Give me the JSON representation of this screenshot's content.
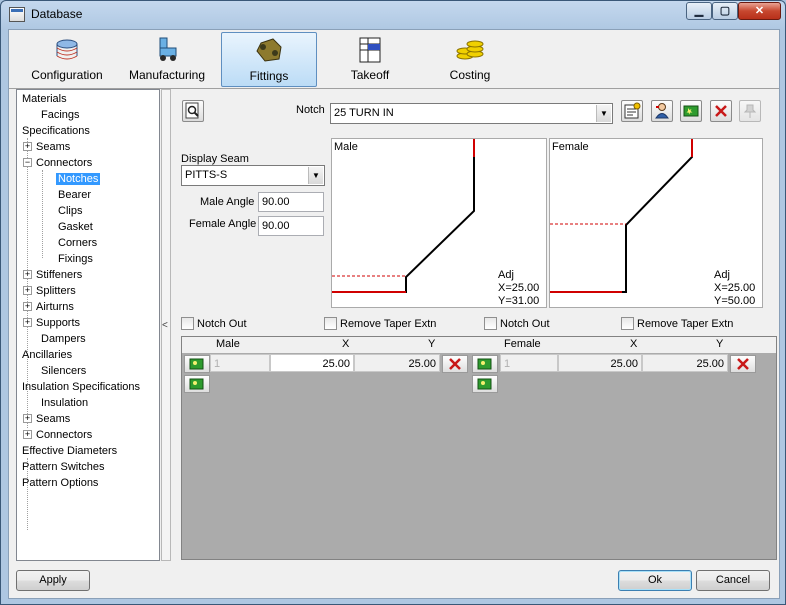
{
  "window": {
    "title": "Database"
  },
  "toolbar": {
    "items": [
      {
        "label": "Configuration",
        "icon": "configuration-icon"
      },
      {
        "label": "Manufacturing",
        "icon": "manufacturing-icon"
      },
      {
        "label": "Fittings",
        "icon": "fittings-icon",
        "active": true
      },
      {
        "label": "Takeoff",
        "icon": "takeoff-icon"
      },
      {
        "label": "Costing",
        "icon": "costing-icon"
      }
    ]
  },
  "tree": {
    "items": [
      {
        "label": "Materials"
      },
      {
        "label": "Facings"
      },
      {
        "label": "Specifications"
      },
      {
        "label": "Seams",
        "expander": "+"
      },
      {
        "label": "Connectors",
        "expander": "−"
      },
      {
        "label": "Notches",
        "selected": true
      },
      {
        "label": "Bearer"
      },
      {
        "label": "Clips"
      },
      {
        "label": "Gasket"
      },
      {
        "label": "Corners"
      },
      {
        "label": "Fixings"
      },
      {
        "label": "Stiffeners",
        "expander": "+"
      },
      {
        "label": "Splitters",
        "expander": "+"
      },
      {
        "label": "Airturns",
        "expander": "+"
      },
      {
        "label": "Supports",
        "expander": "+"
      },
      {
        "label": "Dampers"
      },
      {
        "label": "Ancillaries"
      },
      {
        "label": "Silencers"
      },
      {
        "label": "Insulation Specifications"
      },
      {
        "label": "Insulation"
      },
      {
        "label": "Seams",
        "expander": "+"
      },
      {
        "label": "Connectors",
        "expander": "+"
      },
      {
        "label": "Effective Diameters"
      },
      {
        "label": "Pattern Switches"
      },
      {
        "label": "Pattern Options"
      }
    ],
    "splitter_glyph": "<"
  },
  "notch": {
    "label": "Notch",
    "value": "25 TURN IN"
  },
  "display_seam": {
    "label": "Display Seam",
    "value": "PITTS-S"
  },
  "male_angle": {
    "label": "Male Angle",
    "value": "90.00"
  },
  "female_angle": {
    "label": "Female Angle",
    "value": "90.00"
  },
  "preview_male": {
    "title": "Male",
    "adj": "Adj",
    "x": "X=25.00",
    "y": "Y=31.00"
  },
  "preview_female": {
    "title": "Female",
    "adj": "Adj",
    "x": "X=25.00",
    "y": "Y=50.00"
  },
  "checks": {
    "male_notch_out": "Notch Out",
    "male_remove_taper": "Remove Taper Extn",
    "female_notch_out": "Notch Out",
    "female_remove_taper": "Remove Taper Extn"
  },
  "grid": {
    "male": {
      "headers": [
        "Male",
        "X",
        "Y"
      ],
      "row": {
        "index": "1",
        "x": "25.00",
        "y": "25.00"
      }
    },
    "female": {
      "headers": [
        "Female",
        "X",
        "Y"
      ],
      "row": {
        "index": "1",
        "x": "25.00",
        "y": "25.00"
      }
    }
  },
  "buttons": {
    "apply": "Apply",
    "ok": "Ok",
    "cancel": "Cancel"
  },
  "colors": {
    "accent": "#3399ff",
    "profile_red": "#d00000"
  }
}
